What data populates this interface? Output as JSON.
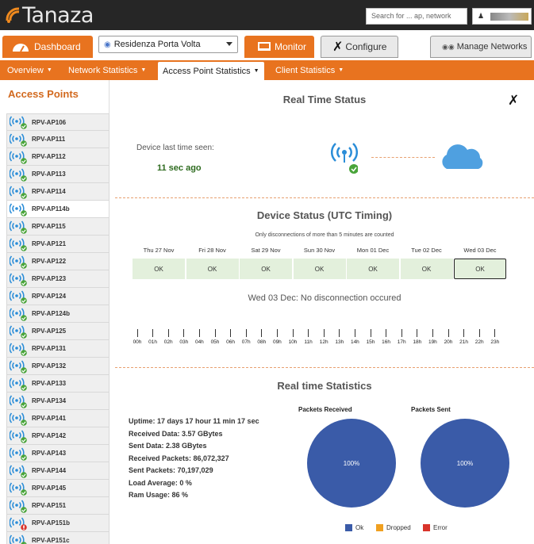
{
  "header": {
    "logo_text": "Tanaza",
    "search_placeholder": "Search for ... ap, network"
  },
  "nav": {
    "dashboard_label": "Dashboard",
    "site_selected": "Residenza Porta Volta",
    "monitor_label": "Monitor",
    "configure_label": "Configure",
    "manage_label": "Manage Networks"
  },
  "subnav": {
    "overview": "Overview",
    "network_stats": "Network Statistics",
    "ap_stats": "Access Point Statistics",
    "client_stats": "Client Statistics"
  },
  "sidebar": {
    "title": "Access Points",
    "items": [
      {
        "label": "RPV-AP106",
        "status": "ok"
      },
      {
        "label": "RPV-AP111",
        "status": "ok"
      },
      {
        "label": "RPV-AP112",
        "status": "ok"
      },
      {
        "label": "RPV-AP113",
        "status": "ok"
      },
      {
        "label": "RPV-AP114",
        "status": "ok"
      },
      {
        "label": "RPV-AP114b",
        "status": "ok"
      },
      {
        "label": "RPV-AP115",
        "status": "ok"
      },
      {
        "label": "RPV-AP121",
        "status": "ok"
      },
      {
        "label": "RPV-AP122",
        "status": "ok"
      },
      {
        "label": "RPV-AP123",
        "status": "ok"
      },
      {
        "label": "RPV-AP124",
        "status": "ok"
      },
      {
        "label": "RPV-AP124b",
        "status": "ok"
      },
      {
        "label": "RPV-AP125",
        "status": "ok"
      },
      {
        "label": "RPV-AP131",
        "status": "ok"
      },
      {
        "label": "RPV-AP132",
        "status": "ok"
      },
      {
        "label": "RPV-AP133",
        "status": "ok"
      },
      {
        "label": "RPV-AP134",
        "status": "ok"
      },
      {
        "label": "RPV-AP141",
        "status": "ok"
      },
      {
        "label": "RPV-AP142",
        "status": "ok"
      },
      {
        "label": "RPV-AP143",
        "status": "ok"
      },
      {
        "label": "RPV-AP144",
        "status": "ok"
      },
      {
        "label": "RPV-AP145",
        "status": "ok"
      },
      {
        "label": "RPV-AP151",
        "status": "ok"
      },
      {
        "label": "RPV-AP151b",
        "status": "error"
      },
      {
        "label": "RPV-AP151c",
        "status": "ok"
      }
    ],
    "selected_index": 5
  },
  "realtime": {
    "title": "Real Time Status",
    "last_seen_label": "Device last time seen:",
    "last_seen_value": "11 sec ago"
  },
  "device_status": {
    "title": "Device Status (UTC Timing)",
    "note": "Only disconnections of more than 5 minutes are counted",
    "days": [
      {
        "label": "Thu 27 Nov",
        "status": "OK"
      },
      {
        "label": "Fri 28 Nov",
        "status": "OK"
      },
      {
        "label": "Sat 29 Nov",
        "status": "OK"
      },
      {
        "label": "Sun 30 Nov",
        "status": "OK"
      },
      {
        "label": "Mon 01 Dec",
        "status": "OK"
      },
      {
        "label": "Tue 02 Dec",
        "status": "OK"
      },
      {
        "label": "Wed 03 Dec",
        "status": "OK"
      }
    ],
    "selected_day_index": 6,
    "message": "Wed 03 Dec: No disconnection occured",
    "hours": [
      "00h",
      "01h",
      "02h",
      "03h",
      "04h",
      "05h",
      "06h",
      "07h",
      "08h",
      "09h",
      "10h",
      "11h",
      "12h",
      "13h",
      "14h",
      "15h",
      "16h",
      "17h",
      "18h",
      "19h",
      "20h",
      "21h",
      "22h",
      "23h"
    ]
  },
  "statistics": {
    "title": "Real time Statistics",
    "lines": [
      "Uptime: 17 days 17 hour 11 min 17 sec",
      "Received Data: 3.57 GBytes",
      "Sent Data: 2.38 GBytes",
      "Received Packets: 86,072,327",
      "Sent Packets: 70,197,029",
      "Load Average: 0 %",
      "Ram Usage: 86 %"
    ]
  },
  "chart_data": [
    {
      "type": "pie",
      "title": "Packets Received",
      "categories": [
        "Ok",
        "Dropped",
        "Error"
      ],
      "values": [
        100,
        0,
        0
      ],
      "data_labels": [
        "100%"
      ]
    },
    {
      "type": "pie",
      "title": "Packets Sent",
      "categories": [
        "Ok",
        "Dropped",
        "Error"
      ],
      "values": [
        100,
        0,
        0
      ],
      "data_labels": [
        "100%"
      ]
    }
  ],
  "legend": {
    "items": [
      {
        "label": "Ok",
        "color": "#3a5ba8"
      },
      {
        "label": "Dropped",
        "color": "#f0a020"
      },
      {
        "label": "Error",
        "color": "#d9342b"
      }
    ]
  },
  "colors": {
    "accent": "#e8731f",
    "pie_ok": "#3a5ba8",
    "ok_status": "#49a43a",
    "error_status": "#d9342b",
    "wifi_blue": "#2a8dd8"
  }
}
